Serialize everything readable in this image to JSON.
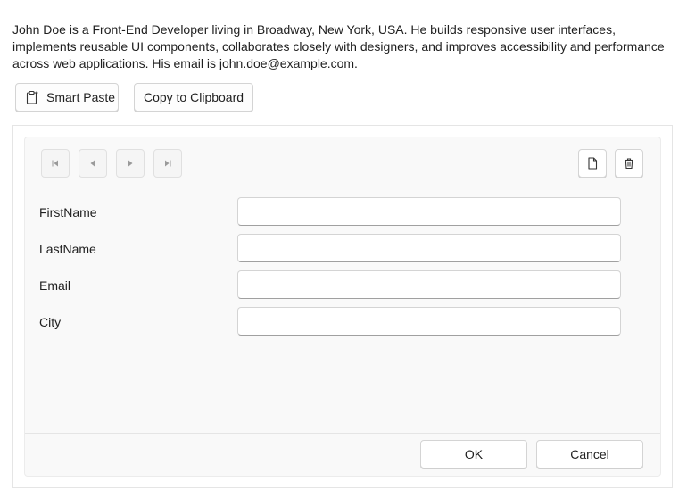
{
  "description": "John Doe is a Front-End Developer living in Broadway, New York, USA. He builds responsive user interfaces, implements reusable UI components, collaborates closely with designers, and improves accessibility and performance across web applications. His email is john.doe@example.com.",
  "toolbar": {
    "smart_paste_label": "Smart Paste",
    "copy_label": "Copy to Clipboard",
    "smart_paste_icon": "clipboard-paste-icon"
  },
  "form": {
    "nav_icons": [
      "first-page-icon",
      "previous-icon",
      "next-icon",
      "last-page-icon"
    ],
    "tool_icons": [
      "new-document-icon",
      "trash-icon"
    ],
    "fields": [
      {
        "label": "FirstName",
        "value": ""
      },
      {
        "label": "LastName",
        "value": ""
      },
      {
        "label": "Email",
        "value": ""
      },
      {
        "label": "City",
        "value": ""
      }
    ],
    "ok_label": "OK",
    "cancel_label": "Cancel"
  }
}
